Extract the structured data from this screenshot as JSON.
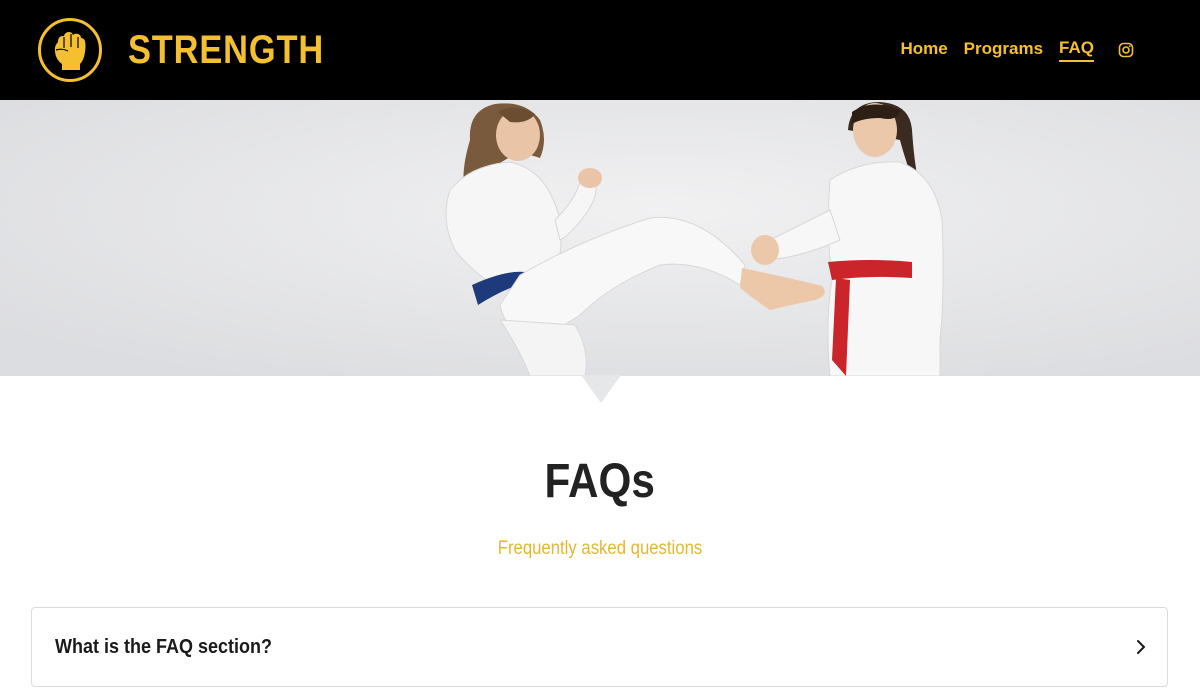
{
  "brand": {
    "name": "STRENGTH",
    "icon": "fist-icon",
    "accent_color": "#f5c030"
  },
  "nav": {
    "items": [
      {
        "label": "Home",
        "active": false
      },
      {
        "label": "Programs",
        "active": false
      },
      {
        "label": "FAQ",
        "active": true
      }
    ],
    "social_icon": "instagram-icon"
  },
  "hero": {
    "image": "two-martial-artists-kicking"
  },
  "page": {
    "title": "FAQs",
    "subtitle": "Frequently asked questions"
  },
  "faq": {
    "items": [
      {
        "question": "What is the FAQ section?",
        "icon": "chevron-right-icon"
      }
    ]
  }
}
